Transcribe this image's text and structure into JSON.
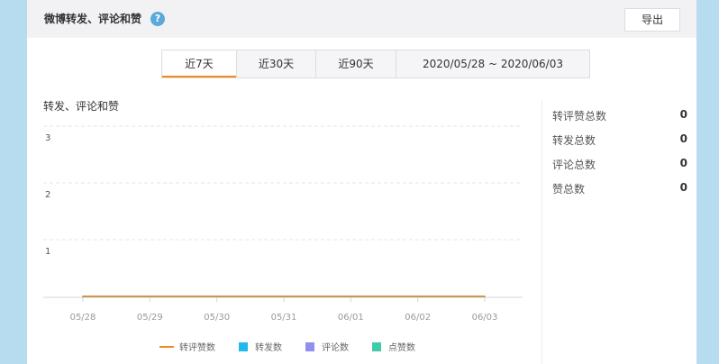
{
  "header": {
    "title": "微博转发、评论和赞",
    "help_icon": "?",
    "export_label": "导出"
  },
  "tabs": [
    {
      "label": "近7天",
      "active": true
    },
    {
      "label": "近30天",
      "active": false
    },
    {
      "label": "近90天",
      "active": false
    },
    {
      "label": "2020/05/28 ~ 2020/06/03",
      "active": false
    }
  ],
  "chart_title": "转发、评论和赞",
  "stats": [
    {
      "label": "转评赞总数",
      "value": "0"
    },
    {
      "label": "转发总数",
      "value": "0"
    },
    {
      "label": "评论总数",
      "value": "0"
    },
    {
      "label": "赞总数",
      "value": "0"
    }
  ],
  "legend": [
    {
      "label": "转评赞数",
      "color": "#f08c1e",
      "kind": "line"
    },
    {
      "label": "转发数",
      "color": "#21b8ee",
      "kind": "box"
    },
    {
      "label": "评论数",
      "color": "#8f8ff0",
      "kind": "box"
    },
    {
      "label": "点赞数",
      "color": "#40ccaa",
      "kind": "box"
    }
  ],
  "chart_data": {
    "type": "line",
    "categories": [
      "05/28",
      "05/29",
      "05/30",
      "05/31",
      "06/01",
      "06/02",
      "06/03"
    ],
    "ylim": [
      0,
      3
    ],
    "yticks": [
      "3",
      "2",
      "1"
    ],
    "grid": true,
    "legend_position": "bottom",
    "series": [
      {
        "name": "转评赞数",
        "color": "#f08c1e",
        "values": [
          0,
          0,
          0,
          0,
          0,
          0,
          0
        ]
      },
      {
        "name": "转发数",
        "color": "#21b8ee",
        "values": [
          0,
          0,
          0,
          0,
          0,
          0,
          0
        ]
      },
      {
        "name": "评论数",
        "color": "#8f8ff0",
        "values": [
          0,
          0,
          0,
          0,
          0,
          0,
          0
        ]
      },
      {
        "name": "点赞数",
        "color": "#40ccaa",
        "values": [
          0,
          0,
          0,
          0,
          0,
          0,
          0
        ]
      }
    ]
  }
}
